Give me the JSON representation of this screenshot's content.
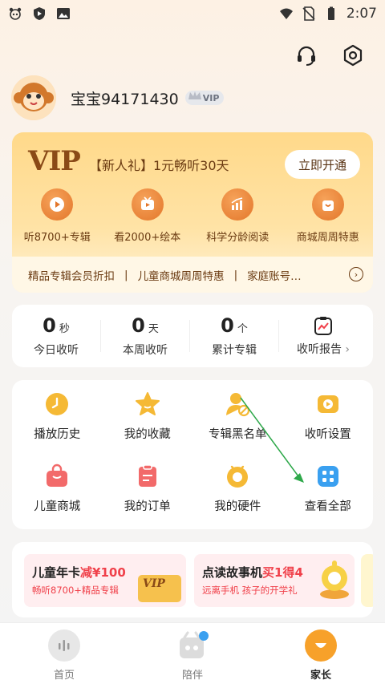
{
  "status_bar": {
    "time": "2:07",
    "left_icons": [
      "panda-icon",
      "play-shield-icon",
      "image-icon"
    ],
    "right_icons": [
      "wifi-icon",
      "no-sim-icon",
      "battery-icon"
    ]
  },
  "top_actions": {
    "icons": [
      "headset-icon",
      "settings-icon"
    ]
  },
  "profile": {
    "username": "宝宝94171430",
    "vip_label": "VIP"
  },
  "vip_card": {
    "logo": "VIP",
    "promo": "【新人礼】1元畅听30天",
    "cta": "立即开通",
    "benefits": [
      {
        "label": "听8700+专辑",
        "icon": "play-icon"
      },
      {
        "label": "看2000+绘本",
        "icon": "tv-icon"
      },
      {
        "label": "科学分龄阅读",
        "icon": "chart-icon"
      },
      {
        "label": "商城周周特惠",
        "icon": "heart-bag-icon"
      }
    ],
    "ticker": [
      "精品专辑会员折扣",
      "儿童商城周周特惠",
      "家庭账号…"
    ]
  },
  "stats": {
    "items": [
      {
        "value": "0",
        "unit": "秒",
        "label": "今日收听"
      },
      {
        "value": "0",
        "unit": "天",
        "label": "本周收听"
      },
      {
        "value": "0",
        "unit": "个",
        "label": "累计专辑"
      }
    ],
    "report_label": "收听报告",
    "report_chevron": "›"
  },
  "grid": {
    "items": [
      {
        "label": "播放历史",
        "icon": "clock-icon",
        "color": "#f5b935"
      },
      {
        "label": "我的收藏",
        "icon": "star-icon",
        "color": "#f5b935"
      },
      {
        "label": "专辑黑名单",
        "icon": "block-user-icon",
        "color": "#f5b935"
      },
      {
        "label": "收听设置",
        "icon": "play-settings-icon",
        "color": "#f5b935"
      },
      {
        "label": "儿童商城",
        "icon": "shopping-bag-icon",
        "color": "#f26a6a"
      },
      {
        "label": "我的订单",
        "icon": "order-icon",
        "color": "#f26a6a"
      },
      {
        "label": "我的硬件",
        "icon": "device-icon",
        "color": "#f5b935"
      },
      {
        "label": "查看全部",
        "icon": "grid-all-icon",
        "color": "#3aa0f0"
      }
    ]
  },
  "promos": [
    {
      "title_prefix": "儿童年卡",
      "title_highlight": "减¥100",
      "sub": "畅听8700+精品专辑",
      "badge": "VIP"
    },
    {
      "title_prefix": "点读故事机",
      "title_highlight": "买1得4",
      "sub": "远离手机  孩子的开学礼"
    }
  ],
  "tabbar": {
    "tabs": [
      {
        "label": "首页",
        "icon": "audio-bars-icon"
      },
      {
        "label": "陪伴",
        "icon": "companion-icon"
      },
      {
        "label": "家长",
        "icon": "parent-icon"
      }
    ],
    "active": "家长"
  },
  "colors": {
    "accent_gold": "#ffd98a",
    "vip_brown": "#6b3b12",
    "highlight_red": "#f0404a",
    "annotation_green": "#2ea84a"
  }
}
